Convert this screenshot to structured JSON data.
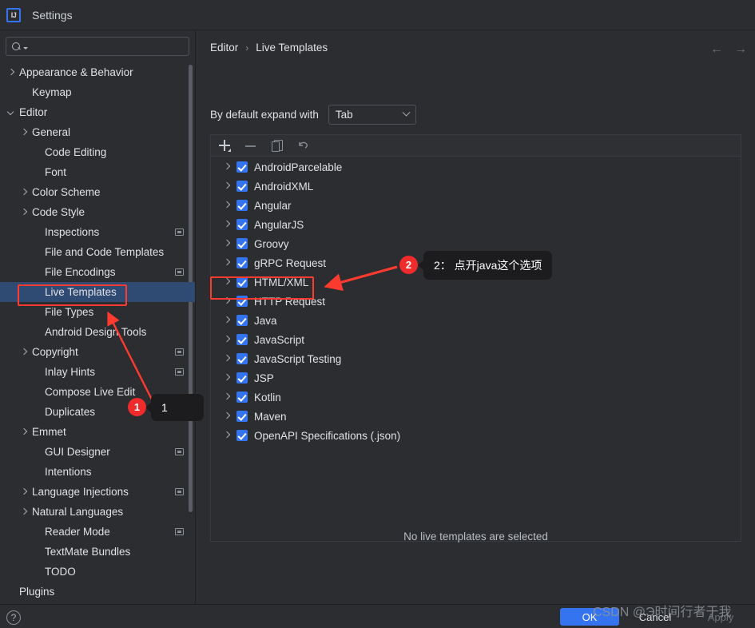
{
  "window": {
    "title": "Settings",
    "logo_icon": "intellij-idea-logo"
  },
  "sidebar": {
    "search": {
      "value": "",
      "placeholder": "",
      "icon": "search-icon"
    },
    "items": [
      {
        "label": "Appearance & Behavior",
        "indent": 0,
        "chevron": "right",
        "badge": false,
        "selected": false
      },
      {
        "label": "Keymap",
        "indent": 1,
        "chevron": "none",
        "badge": false,
        "selected": false
      },
      {
        "label": "Editor",
        "indent": 0,
        "chevron": "down",
        "badge": false,
        "selected": false
      },
      {
        "label": "General",
        "indent": 1,
        "chevron": "right",
        "badge": false,
        "selected": false
      },
      {
        "label": "Code Editing",
        "indent": 2,
        "chevron": "none",
        "badge": false,
        "selected": false
      },
      {
        "label": "Font",
        "indent": 2,
        "chevron": "none",
        "badge": false,
        "selected": false
      },
      {
        "label": "Color Scheme",
        "indent": 1,
        "chevron": "right",
        "badge": false,
        "selected": false
      },
      {
        "label": "Code Style",
        "indent": 1,
        "chevron": "right",
        "badge": false,
        "selected": false
      },
      {
        "label": "Inspections",
        "indent": 2,
        "chevron": "none",
        "badge": true,
        "selected": false
      },
      {
        "label": "File and Code Templates",
        "indent": 2,
        "chevron": "none",
        "badge": false,
        "selected": false
      },
      {
        "label": "File Encodings",
        "indent": 2,
        "chevron": "none",
        "badge": true,
        "selected": false
      },
      {
        "label": "Live Templates",
        "indent": 2,
        "chevron": "none",
        "badge": false,
        "selected": true
      },
      {
        "label": "File Types",
        "indent": 2,
        "chevron": "none",
        "badge": false,
        "selected": false
      },
      {
        "label": "Android Design Tools",
        "indent": 2,
        "chevron": "none",
        "badge": false,
        "selected": false
      },
      {
        "label": "Copyright",
        "indent": 1,
        "chevron": "right",
        "badge": true,
        "selected": false
      },
      {
        "label": "Inlay Hints",
        "indent": 2,
        "chevron": "none",
        "badge": true,
        "selected": false
      },
      {
        "label": "Compose Live Edit",
        "indent": 2,
        "chevron": "none",
        "badge": false,
        "selected": false
      },
      {
        "label": "Duplicates",
        "indent": 2,
        "chevron": "none",
        "badge": false,
        "selected": false
      },
      {
        "label": "Emmet",
        "indent": 1,
        "chevron": "right",
        "badge": false,
        "selected": false
      },
      {
        "label": "GUI Designer",
        "indent": 2,
        "chevron": "none",
        "badge": true,
        "selected": false
      },
      {
        "label": "Intentions",
        "indent": 2,
        "chevron": "none",
        "badge": false,
        "selected": false
      },
      {
        "label": "Language Injections",
        "indent": 1,
        "chevron": "right",
        "badge": true,
        "selected": false
      },
      {
        "label": "Natural Languages",
        "indent": 1,
        "chevron": "right",
        "badge": false,
        "selected": false
      },
      {
        "label": "Reader Mode",
        "indent": 2,
        "chevron": "none",
        "badge": true,
        "selected": false
      },
      {
        "label": "TextMate Bundles",
        "indent": 2,
        "chevron": "none",
        "badge": false,
        "selected": false
      },
      {
        "label": "TODO",
        "indent": 2,
        "chevron": "none",
        "badge": false,
        "selected": false
      },
      {
        "label": "Plugins",
        "indent": 0,
        "chevron": "none",
        "badge": false,
        "selected": false
      }
    ]
  },
  "main": {
    "breadcrumb": {
      "parent": "Editor",
      "separator": "›",
      "current": "Live Templates"
    },
    "nav": {
      "back_icon": "arrow-left-icon",
      "forward_icon": "arrow-right-icon",
      "back_glyph": "←",
      "forward_glyph": "→"
    },
    "expand_with": {
      "label": "By default expand with",
      "value": "Tab"
    },
    "toolbar": {
      "add_label": "+",
      "remove_label": "−",
      "duplicate_label": "Duplicate",
      "revert_label": "Revert"
    },
    "templates": [
      {
        "label": "AndroidParcelable",
        "checked": true
      },
      {
        "label": "AndroidXML",
        "checked": true
      },
      {
        "label": "Angular",
        "checked": true
      },
      {
        "label": "AngularJS",
        "checked": true
      },
      {
        "label": "Groovy",
        "checked": true
      },
      {
        "label": "gRPC Request",
        "checked": true
      },
      {
        "label": "HTML/XML",
        "checked": true
      },
      {
        "label": "HTTP Request",
        "checked": true
      },
      {
        "label": "Java",
        "checked": true
      },
      {
        "label": "JavaScript",
        "checked": true
      },
      {
        "label": "JavaScript Testing",
        "checked": true
      },
      {
        "label": "JSP",
        "checked": true
      },
      {
        "label": "Kotlin",
        "checked": true
      },
      {
        "label": "Maven",
        "checked": true
      },
      {
        "label": "OpenAPI Specifications (.json)",
        "checked": true
      }
    ],
    "empty_message": "No live templates are selected"
  },
  "footer": {
    "help_label": "?",
    "ok_label": "OK",
    "cancel_label": "Cancel",
    "apply_label": "Apply"
  },
  "annotations": [
    {
      "number": "1",
      "text": "1"
    },
    {
      "number": "2",
      "text": "2： 点开java这个选项"
    }
  ],
  "watermark": "CSDN @Э时间行者于我",
  "colors": {
    "accent": "#3574f0",
    "selection": "#2f4a73",
    "annotation": "#ff3b30",
    "background": "#2b2d30"
  }
}
